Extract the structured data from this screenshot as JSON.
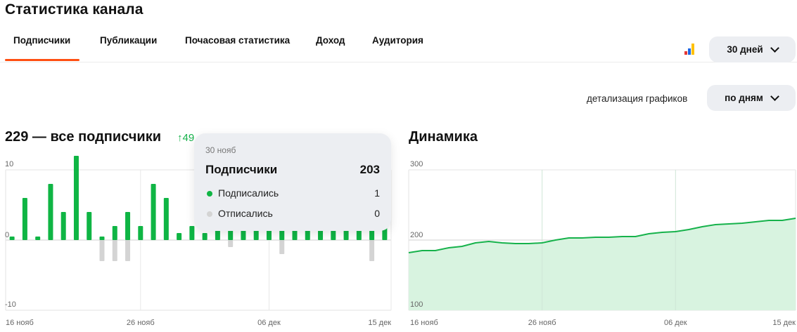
{
  "page": {
    "title": "Статистика канала"
  },
  "tabs": [
    {
      "label": "Подписчики",
      "active": true
    },
    {
      "label": "Публикации"
    },
    {
      "label": "Почасовая статистика"
    },
    {
      "label": "Доход"
    },
    {
      "label": "Аудитория"
    }
  ],
  "toolbar": {
    "period_label": "30 дней",
    "detail_label": "детализация графиков",
    "detail_value": "по дням"
  },
  "colors": {
    "accent": "#ff4f12",
    "green": "#0fb544",
    "gray": "#d4d4d4",
    "area": "#d8f3e0",
    "line": "#16b24b"
  },
  "left_card": {
    "title": "229 — все подписчики",
    "growth": "↑49"
  },
  "right_card": {
    "title": "Динамика"
  },
  "tooltip": {
    "date": "30 нояб",
    "title": "Подписчики",
    "total": "203",
    "rows": [
      {
        "label": "Подписались",
        "value": "1",
        "color": "#0fb544"
      },
      {
        "label": "Отписались",
        "value": "0",
        "color": "#d4d4d4"
      }
    ]
  },
  "chart_data": [
    {
      "type": "bar",
      "title": "229 — все подписчики",
      "ylim": [
        -10,
        10
      ],
      "y_ticks": [
        "10",
        "0",
        "-10"
      ],
      "x_tick_labels": [
        "16 нояб",
        "26 нояб",
        "06 дек",
        "15 дек"
      ],
      "categories": [
        "16 нояб",
        "17 нояб",
        "18 нояб",
        "19 нояб",
        "20 нояб",
        "21 нояб",
        "22 нояб",
        "23 нояб",
        "24 нояб",
        "25 нояб",
        "26 нояб",
        "27 нояб",
        "28 нояб",
        "29 нояб",
        "30 нояб",
        "01 дек",
        "02 дек",
        "03 дек",
        "04 дек",
        "05 дек",
        "06 дек",
        "07 дек",
        "08 дек",
        "09 дек",
        "10 дек",
        "11 дек",
        "12 дек",
        "13 дек",
        "14 дек",
        "15 дек"
      ],
      "series": [
        {
          "name": "Подписались",
          "values": [
            0.5,
            6,
            0.5,
            8,
            4,
            12,
            4,
            0.5,
            2,
            4,
            2,
            8,
            6,
            1,
            2,
            1,
            2,
            2,
            3,
            3,
            3,
            2,
            3,
            3,
            3,
            3,
            2,
            3,
            3,
            3
          ]
        },
        {
          "name": "Отписались",
          "values": [
            0,
            0,
            0,
            0,
            0,
            0,
            0,
            -3,
            -3,
            -3,
            0,
            0,
            0,
            0,
            0,
            0,
            0,
            -1,
            0,
            0,
            0,
            -2,
            0,
            0,
            0,
            0,
            0,
            0,
            -3,
            0
          ]
        }
      ]
    },
    {
      "type": "area",
      "title": "Динамика",
      "ylim": [
        100,
        300
      ],
      "y_ticks": [
        "300",
        "200",
        "100"
      ],
      "x_tick_labels": [
        "16 нояб",
        "26 нояб",
        "06 дек",
        "15 дек"
      ],
      "values": [
        182,
        185,
        185,
        189,
        191,
        196,
        198,
        196,
        195,
        195,
        196,
        200,
        203,
        203,
        204,
        204,
        205,
        205,
        209,
        211,
        212,
        215,
        219,
        222,
        223,
        224,
        226,
        228,
        228,
        231
      ]
    }
  ]
}
